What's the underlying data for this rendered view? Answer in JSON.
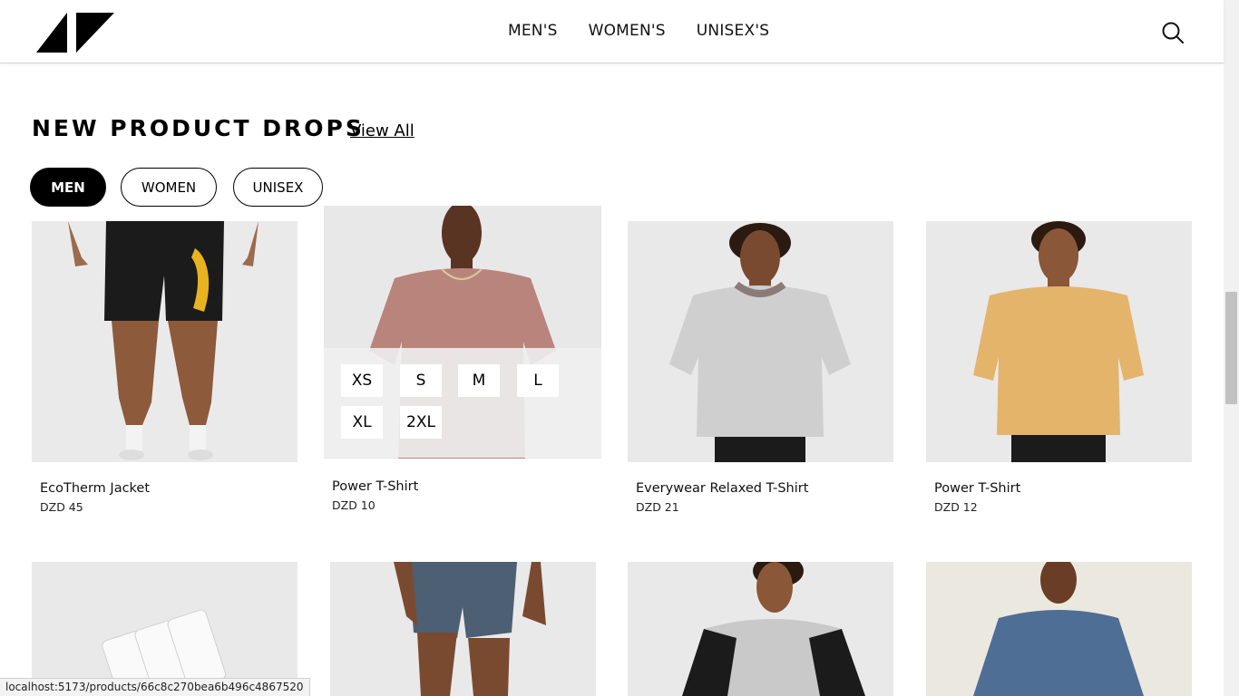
{
  "header": {
    "nav": [
      "MEN'S",
      "WOMEN'S",
      "UNISEX'S"
    ]
  },
  "section": {
    "title": "NEW PRODUCT DROPS",
    "view_all": "View All"
  },
  "filters": {
    "men": "MEN",
    "women": "WOMEN",
    "unisex": "UNISEX",
    "active": "MEN"
  },
  "products": [
    {
      "name": "EcoTherm Jacket",
      "price": "DZD 45"
    },
    {
      "name": "Power T-Shirt",
      "price": "DZD 10",
      "sizes": [
        "XS",
        "S",
        "M",
        "L",
        "XL",
        "2XL"
      ]
    },
    {
      "name": "Everywear Relaxed T-Shirt",
      "price": "DZD 21"
    },
    {
      "name": "Power T-Shirt",
      "price": "DZD 12"
    }
  ],
  "status_bar": {
    "url": "localhost:5173/products/66c8c270bea6b496c4867520"
  },
  "colors": {
    "accent": "#000000",
    "card_bg": "#e9e9ea",
    "tan_shirt": "#e3b46a",
    "mauve_shirt": "#b9847c",
    "grey_shirt": "#cfcfcf",
    "blue_sweater": "#4e6e96"
  }
}
